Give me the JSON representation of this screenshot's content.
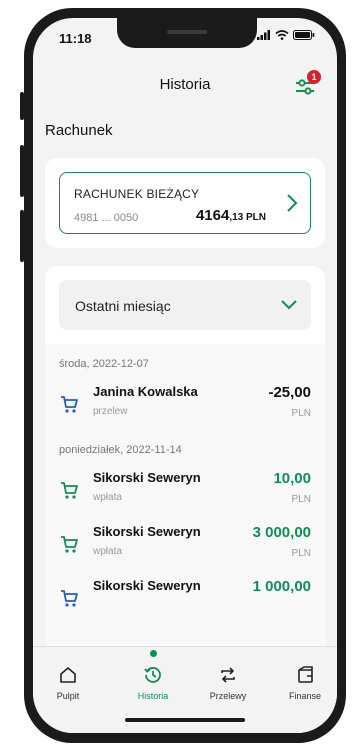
{
  "status_bar": {
    "time": "11:18"
  },
  "header": {
    "title": "Historia",
    "filter_badge": "1"
  },
  "section": {
    "title": "Rachunek"
  },
  "account": {
    "name": "RACHUNEK BIEŻĄCY",
    "number": "4981 ... 0050",
    "balance_main": "4164",
    "balance_decimal": ",13 PLN"
  },
  "filter": {
    "period": "Ostatni miesiąc"
  },
  "transactions": [
    {
      "date": "środa, 2022-12-07"
    },
    {
      "name": "Janina Kowalska",
      "type": "przelew",
      "amount": "-25,00",
      "currency": "PLN"
    },
    {
      "date": "poniedziałek, 2022-11-14"
    },
    {
      "name": "Sikorski Seweryn",
      "type": "wpłata",
      "amount": "10,00",
      "currency": "PLN"
    },
    {
      "name": "Sikorski Seweryn",
      "type": "wpłata",
      "amount": "3 000,00",
      "currency": "PLN"
    },
    {
      "name": "Sikorski Seweryn",
      "amount": "1 000,00"
    }
  ],
  "nav": {
    "items": [
      {
        "label": "Pulpit",
        "icon": "home-icon"
      },
      {
        "label": "Historia",
        "icon": "history-icon"
      },
      {
        "label": "Przelewy",
        "icon": "transfer-icon"
      },
      {
        "label": "Finanse",
        "icon": "finance-icon"
      }
    ]
  },
  "colors": {
    "accent": "#0f8f57",
    "badge": "#d7212a",
    "card_border": "#1e8a5c"
  }
}
